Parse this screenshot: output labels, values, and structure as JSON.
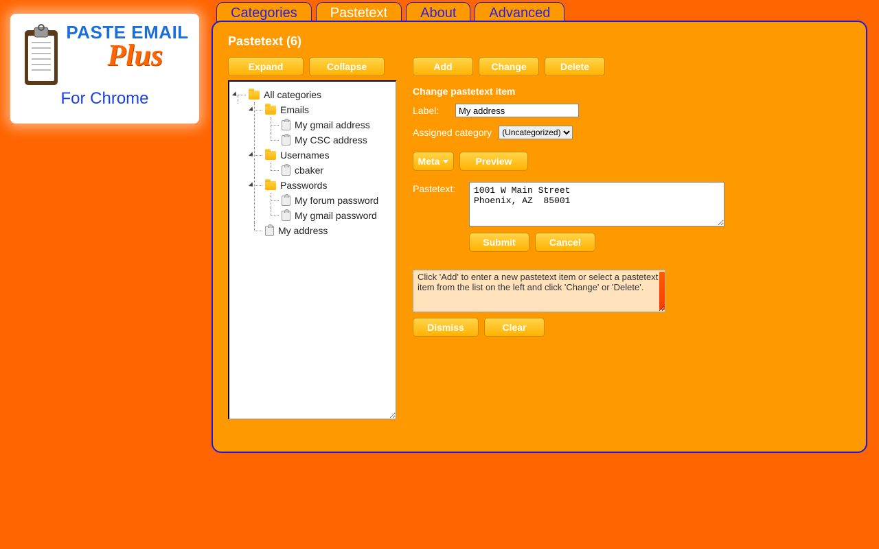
{
  "logo": {
    "title": "Paste Email",
    "plus": "Plus",
    "sub": "For Chrome"
  },
  "tabs": {
    "categories": "Categories",
    "pastetext": "Pastetext",
    "about": "About",
    "advanced": "Advanced"
  },
  "panel": {
    "title": "Pastetext  (6)",
    "expand": "Expand",
    "collapse": "Collapse"
  },
  "tree": {
    "root": "All categories",
    "emails": "Emails",
    "emails_items": {
      "0": "My gmail address",
      "1": "My CSC address"
    },
    "usernames": "Usernames",
    "usernames_items": {
      "0": "cbaker"
    },
    "passwords": "Passwords",
    "passwords_items": {
      "0": "My forum password",
      "1": "My gmail password"
    },
    "uncat": "My address"
  },
  "actions": {
    "add": "Add",
    "change": "Change",
    "delete": "Delete"
  },
  "form": {
    "header": "Change pastetext item",
    "label_label": "Label:",
    "label_value": "My address",
    "cat_label": "Assigned category",
    "cat_value": "(Uncategorized)",
    "meta": "Meta",
    "preview": "Preview",
    "paste_label": "Pastetext:",
    "paste_value": "1001 W Main Street\nPhoenix, AZ  85001",
    "submit": "Submit",
    "cancel": "Cancel"
  },
  "hint": {
    "text": "Click 'Add' to enter a new pastetext item or select a pastetext item from the list on the left and click 'Change' or 'Delete'.",
    "dismiss": "Dismiss",
    "clear": "Clear"
  }
}
